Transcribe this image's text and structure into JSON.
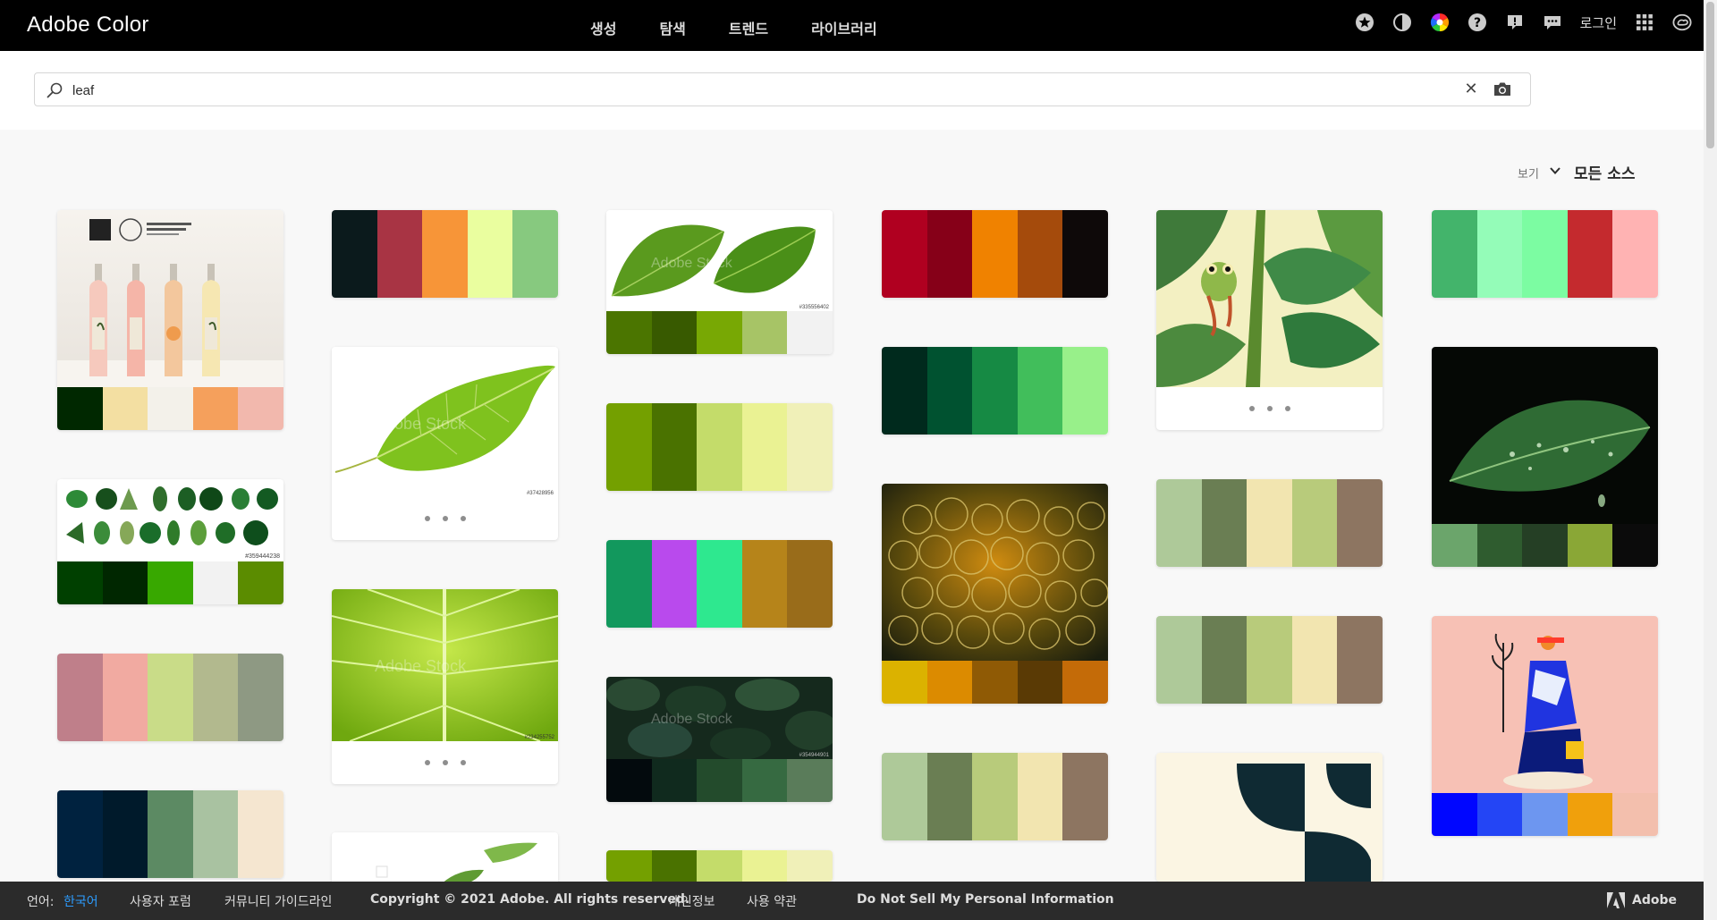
{
  "header": {
    "brand": "Adobe Color",
    "nav": [
      "생성",
      "탐색",
      "트렌드",
      "라이브러리"
    ],
    "login": "로그인"
  },
  "search": {
    "value": "leaf",
    "placeholder": ""
  },
  "view": {
    "label": "보기",
    "value": "모든 소스"
  },
  "footer": {
    "lang_label": "언어:",
    "lang_value": "한국어",
    "forum": "사용자 포럼",
    "guidelines": "커뮤니티 가이드라인",
    "copyright": "Copyright © 2021 Adobe. All rights reserved.",
    "privacy": "개인정보",
    "terms": "사용 약관",
    "do_not_sell": "Do Not Sell My Personal Information",
    "adobe": "Adobe"
  },
  "cards": {
    "c1": [
      "#002800",
      "#f3dfa2",
      "#f3f1ea",
      "#f5a05c",
      "#f2b8ad"
    ],
    "c2": [
      "#004000",
      "#002700",
      "#38a800",
      "#f2f2f2",
      "#5b8c00"
    ],
    "c3": [
      "#bf7f8a",
      "#f1aaa1",
      "#c9dc88",
      "#b2b98e",
      "#8e9983"
    ],
    "c4": [
      "#00223f",
      "#001a2b",
      "#5c8a63",
      "#a9c2a1",
      "#f5e6d0"
    ],
    "c5": [
      "#0b1a1c",
      "#a83444",
      "#f79538",
      "#eafe9f",
      "#87c97f"
    ],
    "c6": [
      "#4b7500",
      "#385a00",
      "#78a804",
      "#a7c466",
      "#f2f2f2"
    ],
    "c7": [
      "#74a000",
      "#4a7200",
      "#c4dc6a",
      "#eaf293",
      "#f0f0b8"
    ],
    "c8": [
      "#12985d",
      "#b94aed",
      "#2ee88f",
      "#b6841a",
      "#996c1a"
    ],
    "c9": [
      "#030a0d",
      "#102a1e",
      "#234b2c",
      "#366a41",
      "#5a7c5a"
    ],
    "c10": [
      "#74a000",
      "#4a7200",
      "#c4dc6a",
      "#eaf293",
      "#f0f0b8"
    ],
    "c11": [
      "#b00020",
      "#860018",
      "#f08200",
      "#a54b0c",
      "#0e0909"
    ],
    "c12": [
      "#002a1d",
      "#005230",
      "#168a44",
      "#41be5b",
      "#98f08a"
    ],
    "c13": [
      "#dbb200",
      "#dc8b00",
      "#8f5a05",
      "#5a3a05",
      "#c46b08"
    ],
    "c14": [
      "#aec999",
      "#6a7e53",
      "#b8cb7b",
      "#f2e5b0",
      "#8d7561"
    ],
    "c15": [
      "#aec999",
      "#6a7e53",
      "#f2e5b0",
      "#b8cb7b",
      "#8d7561"
    ],
    "c16": [
      "#aec999",
      "#6a7e53",
      "#b8cb7b",
      "#f2e5b0",
      "#8d7561"
    ],
    "c17": [
      "#43b46b",
      "#94fcb8",
      "#7cfca2",
      "#c42a2e",
      "#ffb3b3"
    ],
    "c18": [
      "#6ba56b",
      "#2f5c2f",
      "#253f25",
      "#8aa736",
      "#0b0b0b"
    ],
    "c19": [
      "#0006ff",
      "#2445f5",
      "#6d96f0",
      "#f0a00c",
      "#f3bfad"
    ]
  },
  "stock_ids": {
    "s1": "#359444238",
    "s2": "#37428956",
    "s3": "#335556402",
    "s4": "#234255752",
    "s5": "#354944901"
  }
}
